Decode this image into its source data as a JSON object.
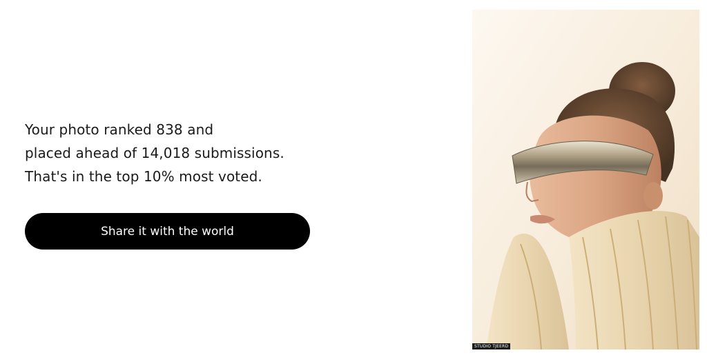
{
  "result": {
    "line1": "Your photo ranked 838 and",
    "line2": "placed ahead of 14,018 submissions.",
    "line3": "That's in the top 10% most voted."
  },
  "share_button": {
    "label": "Share it with the world"
  },
  "photo": {
    "watermark": "STUDIO TJEERD"
  }
}
